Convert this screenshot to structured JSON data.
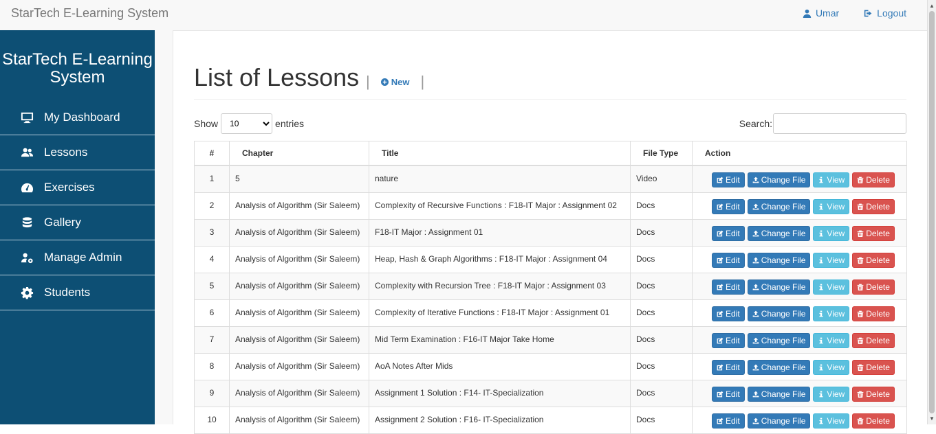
{
  "navbar": {
    "brand": "StarTech E-Learning System",
    "user_label": "Umar",
    "logout_label": "Logout"
  },
  "sidebar": {
    "title": "StarTech E-Learning System",
    "items": [
      {
        "label": "My Dashboard",
        "icon": "monitor-icon"
      },
      {
        "label": "Lessons",
        "icon": "users-icon"
      },
      {
        "label": "Exercises",
        "icon": "gauge-icon"
      },
      {
        "label": "Gallery",
        "icon": "database-icon"
      },
      {
        "label": "Manage Admin",
        "icon": "user-gear-icon"
      },
      {
        "label": "Students",
        "icon": "gear-icon"
      }
    ]
  },
  "page": {
    "title": "List of Lessons",
    "new_label": "New",
    "separator": "|"
  },
  "table_controls": {
    "show_label": "Show",
    "entries_value": "10",
    "entries_label": "entries",
    "search_label": "Search:",
    "search_value": ""
  },
  "table": {
    "headers": [
      "#",
      "Chapter",
      "Title",
      "File Type",
      "Action"
    ],
    "actions": {
      "edit": "Edit",
      "change": "Change File",
      "view": "View",
      "delete": "Delete"
    },
    "rows": [
      {
        "num": "1",
        "chapter": "5",
        "title": "nature",
        "type": "Video"
      },
      {
        "num": "2",
        "chapter": "Analysis of Algorithm (Sir Saleem)",
        "title": "Complexity of Recursive Functions : F18-IT Major : Assignment 02",
        "type": "Docs"
      },
      {
        "num": "3",
        "chapter": "Analysis of Algorithm (Sir Saleem)",
        "title": "F18-IT Major : Assignment 01",
        "type": "Docs"
      },
      {
        "num": "4",
        "chapter": "Analysis of Algorithm (Sir Saleem)",
        "title": "Heap, Hash & Graph Algorithms : F18-IT Major : Assignment 04",
        "type": "Docs"
      },
      {
        "num": "5",
        "chapter": "Analysis of Algorithm (Sir Saleem)",
        "title": "Complexity with Recursion Tree : F18-IT Major : Assignment 03",
        "type": "Docs"
      },
      {
        "num": "6",
        "chapter": "Analysis of Algorithm (Sir Saleem)",
        "title": "Complexity of Iterative Functions : F18-IT Major : Assignment 01",
        "type": "Docs"
      },
      {
        "num": "7",
        "chapter": "Analysis of Algorithm (Sir Saleem)",
        "title": "Mid Term Examination : F16-IT Major Take Home",
        "type": "Docs"
      },
      {
        "num": "8",
        "chapter": "Analysis of Algorithm (Sir Saleem)",
        "title": "AoA Notes After Mids",
        "type": "Docs"
      },
      {
        "num": "9",
        "chapter": "Analysis of Algorithm (Sir Saleem)",
        "title": "Assignment 1 Solution : F14- IT-Specialization",
        "type": "Docs"
      },
      {
        "num": "10",
        "chapter": "Analysis of Algorithm (Sir Saleem)",
        "title": "Assignment 2 Solution : F16- IT-Specialization",
        "type": "Docs"
      }
    ]
  }
}
